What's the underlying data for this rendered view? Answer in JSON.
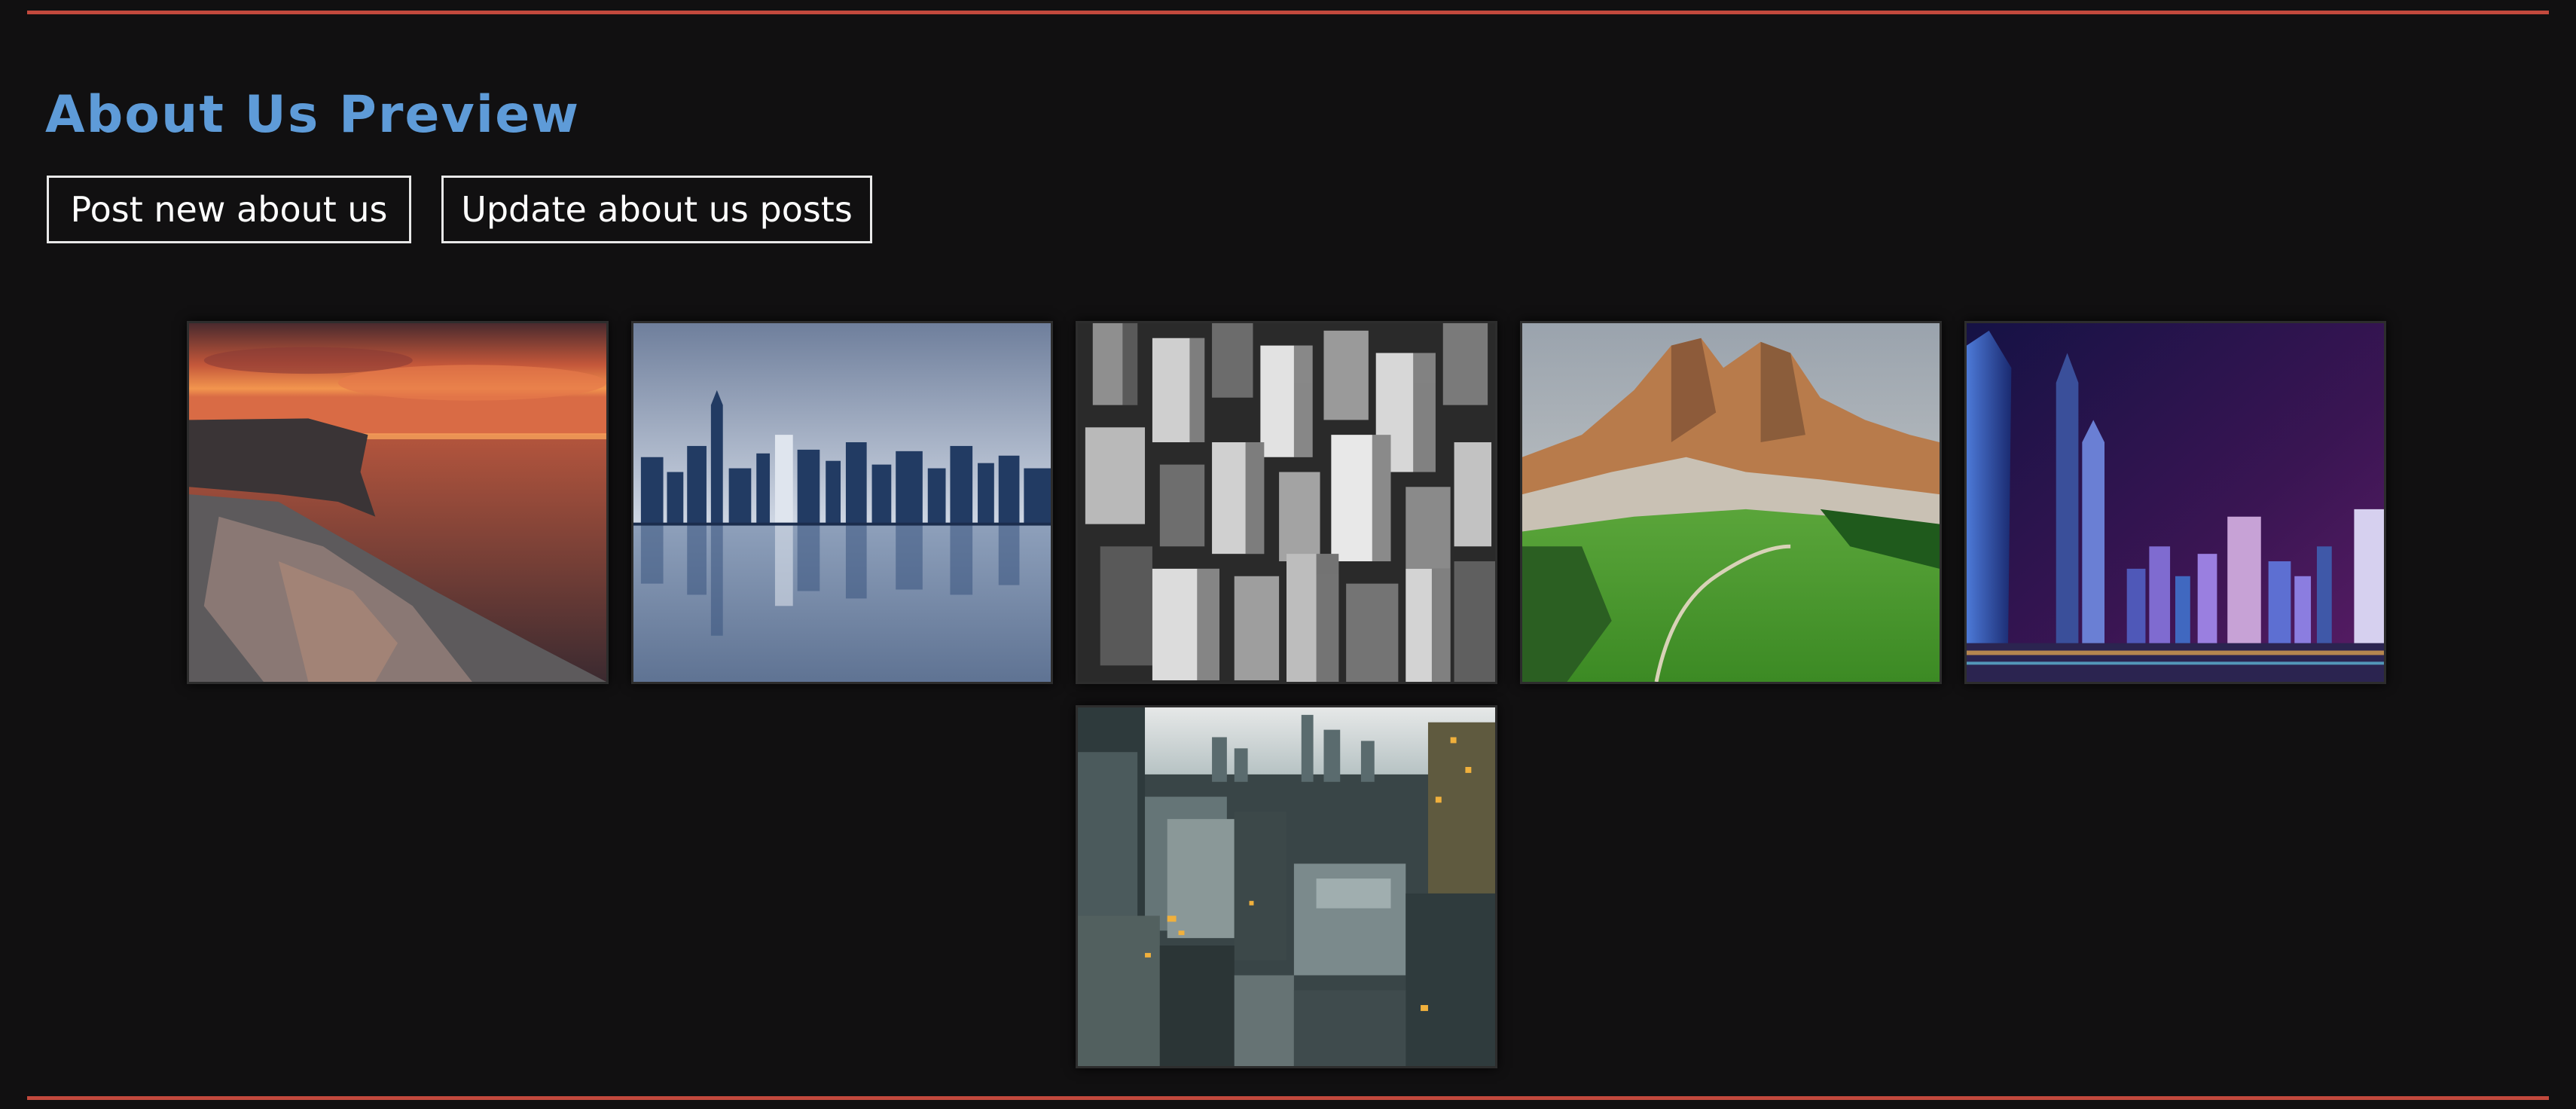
{
  "page": {
    "title": "About Us Preview"
  },
  "actions": {
    "post_label": "Post new about us",
    "update_label": "Update about us posts"
  },
  "colors": {
    "background": "#111011",
    "accent_rule": "#c2493d",
    "title": "#5e9bd8",
    "button_border": "#e8e8e8"
  },
  "gallery": [
    {
      "subject": "sunset-coastal-cliff"
    },
    {
      "subject": "city-skyline-water-reflection"
    },
    {
      "subject": "black-and-white-aerial-skyscrapers"
    },
    {
      "subject": "mountain-peak-green-meadow"
    },
    {
      "subject": "night-city-towers-purple-sky"
    },
    {
      "subject": "aerial-city-downtown-teal"
    }
  ]
}
